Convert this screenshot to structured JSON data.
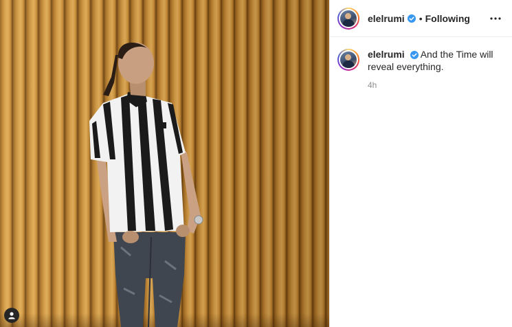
{
  "post": {
    "username": "elelrumi",
    "verified": true,
    "separator": "•",
    "follow_status": "Following",
    "caption": "And the Time will reveal everything.",
    "time_ago": "4h"
  },
  "colors": {
    "verified_badge": "#3897f0",
    "secondary_text": "#8e8e8e",
    "wood": "#c88c36"
  },
  "icons": {
    "more": "three-dots-horizontal",
    "verified": "blue-check-badge",
    "user": "user-silhouette"
  }
}
